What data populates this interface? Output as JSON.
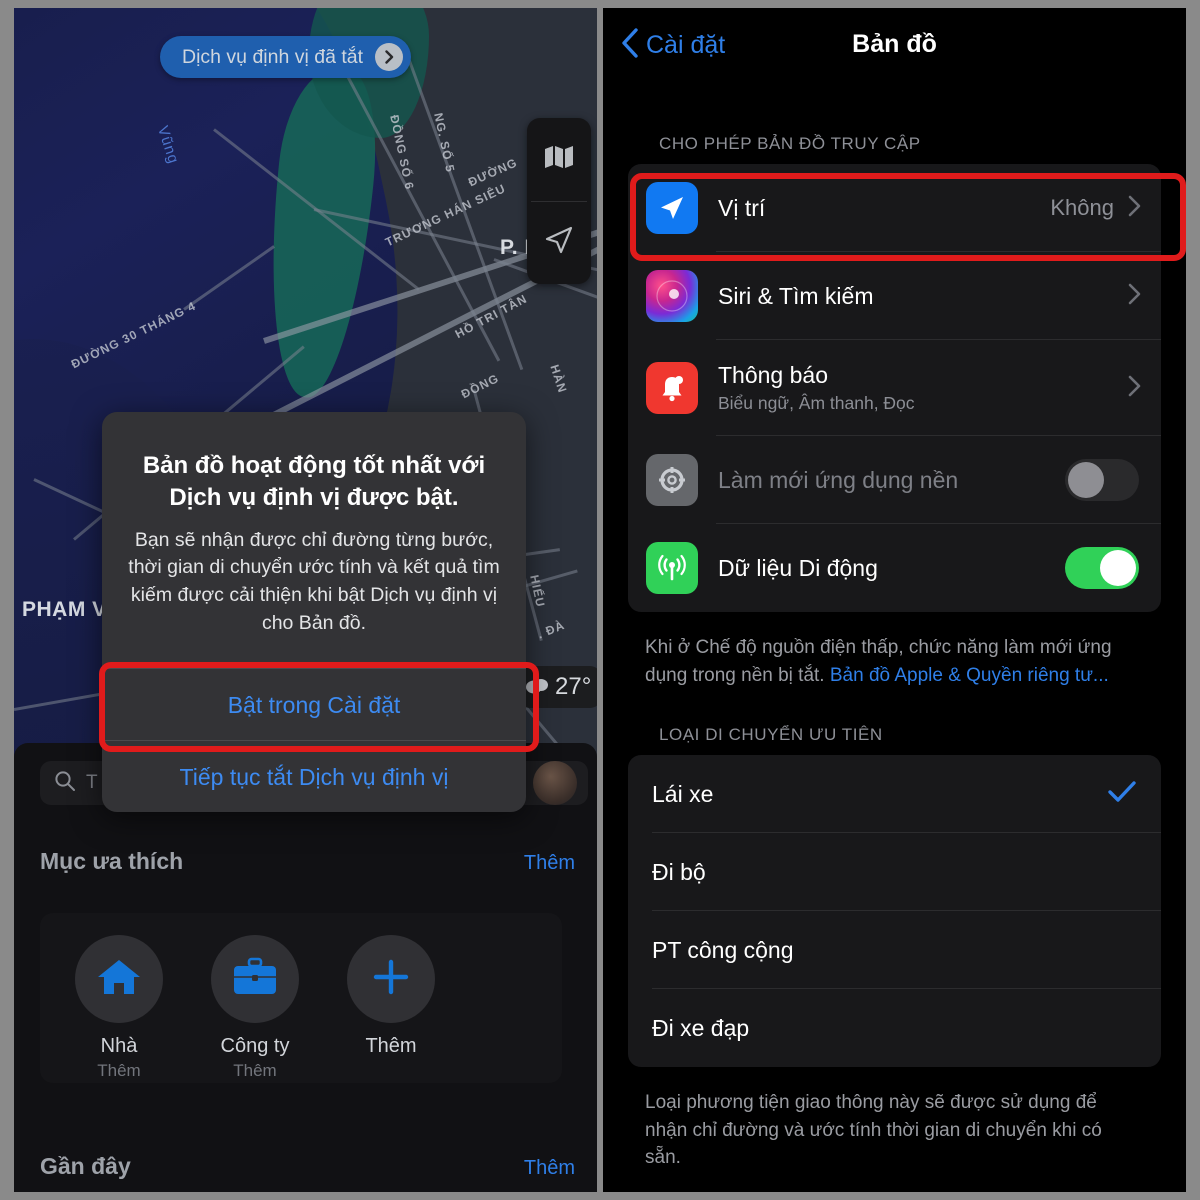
{
  "left_panel": {
    "location_pill": {
      "label": "Dịch vụ định vị đã tắt",
      "icon": "chevron-right-circle-icon"
    },
    "map": {
      "labels": [
        {
          "text": "Vũng",
          "type": "water"
        },
        {
          "text": "ĐỒNG SỐ 6",
          "type": "street"
        },
        {
          "text": "NG. SỐ 5",
          "type": "street"
        },
        {
          "text": "ĐƯỜNG",
          "type": "street"
        },
        {
          "text": "TRƯƠNG HÁN SIÊU",
          "type": "street"
        },
        {
          "text": "ĐƯỜNG 30 THÁNG 4",
          "type": "street"
        },
        {
          "text": "HỒ TRI TÂN",
          "type": "street"
        },
        {
          "text": "ĐỒNG",
          "type": "street"
        },
        {
          "text": "HÀN",
          "type": "street"
        },
        {
          "text": ". ĐÀ",
          "type": "street"
        },
        {
          "text": "PHẠM VĂN",
          "type": "street"
        },
        {
          "text": "HIẾU",
          "type": "street"
        },
        {
          "text": "P. NGỌC D",
          "type": "district"
        }
      ],
      "controls": [
        {
          "name": "map-layers-icon"
        },
        {
          "name": "locate-arrow-icon"
        }
      ],
      "temperature": {
        "value": "27°",
        "icon": "cloud-icon"
      }
    },
    "alert": {
      "title": "Bản đồ hoạt động tốt nhất với Dịch vụ định vị được bật.",
      "body": "Bạn sẽ nhận được chỉ đường từng bước, thời gian di chuyển ước tính và kết quả tìm kiếm được cải thiện khi bật Dịch vụ định vị cho Bản đồ.",
      "primary_action": "Bật trong Cài đặt",
      "secondary_action": "Tiếp tục tắt Dịch vụ định vị"
    },
    "sheet": {
      "search_placeholder": "T",
      "favorites": {
        "title": "Mục ưa thích",
        "more": "Thêm",
        "items": [
          {
            "name": "Nhà",
            "sub": "Thêm",
            "icon": "home-icon"
          },
          {
            "name": "Công ty",
            "sub": "Thêm",
            "icon": "briefcase-icon"
          },
          {
            "name": "Thêm",
            "sub": "",
            "icon": "plus-icon"
          }
        ]
      },
      "recents": {
        "title": "Gần đây",
        "more": "Thêm"
      }
    }
  },
  "right_panel": {
    "nav": {
      "back_label": "Cài đặt",
      "title": "Bản đồ",
      "back_icon": "chevron-left-icon"
    },
    "access_group": {
      "header": "CHO PHÉP BẢN ĐỒ TRUY CẬP",
      "rows": [
        {
          "label": "Vị trí",
          "value": "Không",
          "icon": "location-arrow-icon",
          "accessory": "chevron"
        },
        {
          "label": "Siri & Tìm kiếm",
          "value": "",
          "icon": "siri-icon",
          "accessory": "chevron"
        },
        {
          "label": "Thông báo",
          "sub": "Biểu ngữ, Âm thanh, Đọc",
          "icon": "bell-icon",
          "accessory": "chevron"
        },
        {
          "label": "Làm mới ứng dụng nền",
          "icon": "gear-icon",
          "accessory": "toggle",
          "toggle_on": false,
          "dim": true
        },
        {
          "label": "Dữ liệu Di động",
          "icon": "cellular-icon",
          "accessory": "toggle",
          "toggle_on": true
        }
      ],
      "footnote_text": "Khi ở Chế độ nguồn điện thấp, chức năng làm mới ứng dụng trong nền bị tắt. ",
      "footnote_link": "Bản đồ Apple & Quyền riêng tư..."
    },
    "transport_group": {
      "header": "LOẠI DI CHUYỂN ƯU TIÊN",
      "options": [
        {
          "label": "Lái xe",
          "selected": true
        },
        {
          "label": "Đi bộ",
          "selected": false
        },
        {
          "label": "PT công cộng",
          "selected": false
        },
        {
          "label": "Đi xe đạp",
          "selected": false
        }
      ],
      "footnote": "Loại phương tiện giao thông này sẽ được sử dụng để nhận chỉ đường và ước tính thời gian di chuyển khi có sẵn."
    }
  },
  "annotations": {
    "highlight_color": "#e01b1b",
    "boxes": [
      "alert-primary-action",
      "location-row"
    ]
  }
}
